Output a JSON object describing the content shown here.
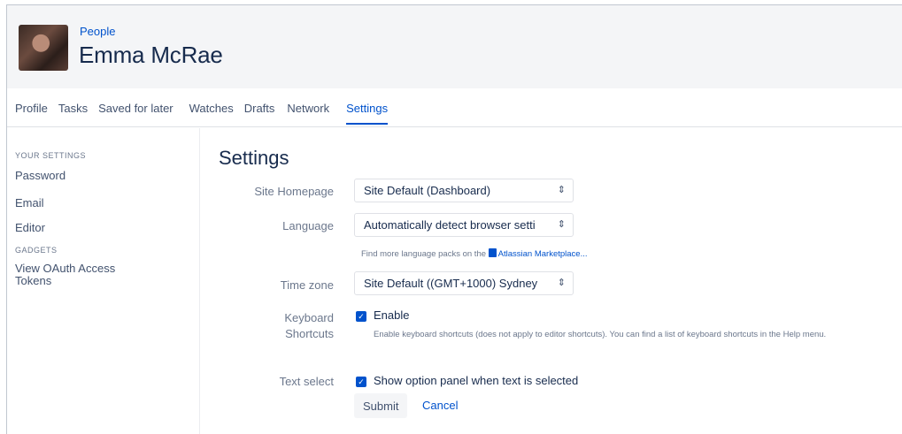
{
  "header": {
    "breadcrumb": "People",
    "person_name": "Emma McRae"
  },
  "tabs": [
    {
      "label": "Profile"
    },
    {
      "label": "Tasks"
    },
    {
      "label": "Saved for later"
    },
    {
      "label": "Watches"
    },
    {
      "label": "Drafts"
    },
    {
      "label": "Network"
    },
    {
      "label": "Settings"
    }
  ],
  "active_tab": "Settings",
  "sidebar": {
    "your_settings_heading": "YOUR SETTINGS",
    "password": "Password",
    "email": "Email",
    "editor": "Editor",
    "gadgets_heading": "GADGETS",
    "oauth_line1": "View OAuth Access",
    "oauth_line2": "Tokens"
  },
  "settings": {
    "title": "Settings",
    "site_homepage_label": "Site Homepage",
    "site_homepage_value": "Site Default (Dashboard)",
    "language_label": "Language",
    "language_value": "Automatically detect browser setti",
    "language_hint_prefix": "Find more language packs on the",
    "language_hint_link": "Atlassian Marketplace...",
    "timezone_label": "Time zone",
    "timezone_value": "Site Default ((GMT+1000) Sydney",
    "keyboard_label_line1": "Keyboard",
    "keyboard_label_line2": "Shortcuts",
    "keyboard_checkbox_label": "Enable",
    "keyboard_checked": true,
    "keyboard_desc": "Enable keyboard shortcuts (does not apply to editor shortcuts). You can find a list of keyboard shortcuts in the Help menu.",
    "text_select_label": "Text select",
    "text_select_checkbox_label": "Show option panel when text is selected",
    "text_select_checked": true,
    "submit_label": "Submit",
    "cancel_label": "Cancel"
  },
  "colors": {
    "accent": "#0052cc",
    "header_bg": "#f4f5f7",
    "muted_text": "#6b778c"
  }
}
